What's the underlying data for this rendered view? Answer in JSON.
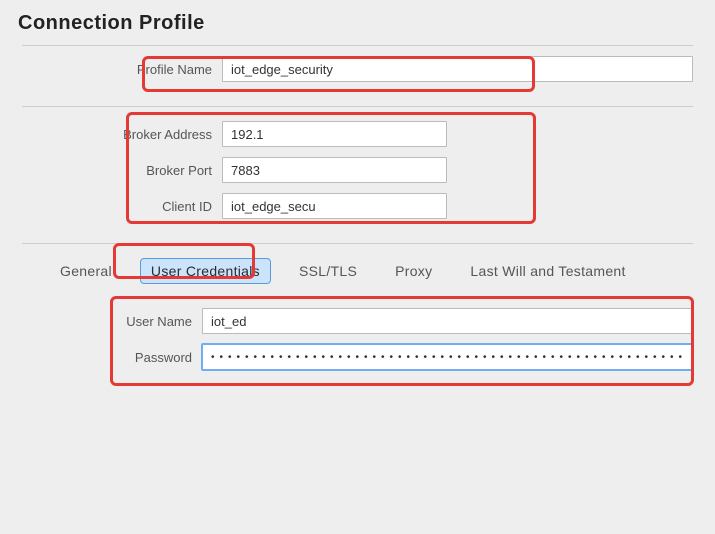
{
  "title": "Connection Profile",
  "profile": {
    "name_label": "Profile Name",
    "name_value": "iot_edge_security"
  },
  "broker": {
    "address_label": "Broker Address",
    "address_value": "192.1",
    "port_label": "Broker Port",
    "port_value": "7883",
    "client_id_label": "Client ID",
    "client_id_value": "iot_edge_secu"
  },
  "tabs": {
    "general": "General",
    "user_credentials": "User Credentials",
    "ssl_tls": "SSL/TLS",
    "proxy": "Proxy",
    "lwt": "Last Will and Testament"
  },
  "credentials": {
    "username_label": "User Name",
    "username_value": "iot_ed",
    "password_label": "Password",
    "password_value": "••••••••••••••••••••••••••••••••••••••••••••••••••••••••••••"
  }
}
